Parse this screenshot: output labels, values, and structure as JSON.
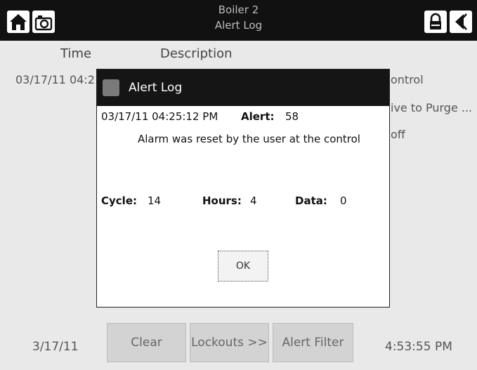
{
  "header": {
    "title_line1": "Boiler 2",
    "title_line2": "Alert Log"
  },
  "icons": {
    "home": "home-icon",
    "camera": "camera-icon",
    "lock": "lock-icon",
    "back": "back-icon"
  },
  "list": {
    "col_time": "Time",
    "col_description": "Description",
    "row1_time": "03/17/11 04:2",
    "row1_desc": "ontrol",
    "row2_desc": "ive to Purge ...",
    "row3_desc": "off"
  },
  "modal": {
    "title": "Alert Log",
    "timestamp": "03/17/11 04:25:12 PM",
    "alert_label": "Alert:",
    "alert_value": "58",
    "message": "Alarm was reset by the user at the control",
    "cycle_label": "Cycle:",
    "cycle_value": "14",
    "hours_label": "Hours:",
    "hours_value": "4",
    "data_label": "Data:",
    "data_value": "0",
    "ok_label": "OK"
  },
  "footer": {
    "date": "3/17/11",
    "time": "4:53:55 PM",
    "clear_label": "Clear",
    "lockouts_label": "Lockouts >>",
    "alert_filter_label": "Alert Filter"
  }
}
